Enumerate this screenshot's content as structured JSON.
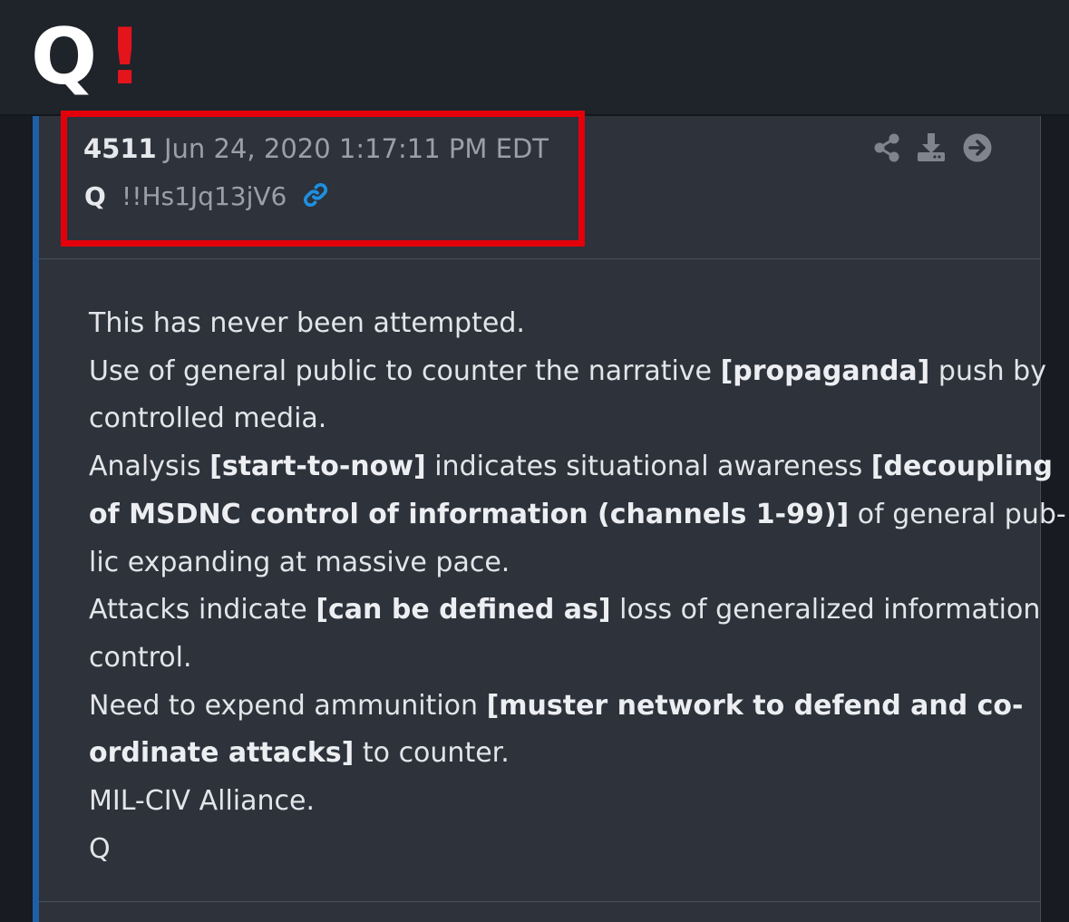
{
  "header": {
    "logo_letter": "Q",
    "logo_mark": "!"
  },
  "post": {
    "number": "4511",
    "date": "Jun 24, 2020 1:17:11 PM EDT",
    "author": "Q",
    "tripcode": "!!Hs1Jq13jV6",
    "icons": {
      "link": "link-icon",
      "share": "share-icon",
      "download": "download-icon",
      "open": "arrow-circle-right-icon"
    },
    "colors": {
      "highlight": "#e3000b",
      "link_icon": "#1e8fe0",
      "accent_border": "#1f5fa5"
    },
    "body": {
      "l1": "This has never been attempted.",
      "l2a": "Use of general public to counter the narrative ",
      "l2b": "[propaganda]",
      "l2c": " push by",
      "l3": "controlled media.",
      "l4a": "Analysis ",
      "l4b": "[start-to-now]",
      "l4c": " indicates situational awareness ",
      "l4d": "[decoupling",
      "l5a": "of MSDNC control of information (channels 1-99)]",
      "l5b": " of general pub-",
      "l6": "lic expanding at massive pace.",
      "l7a": "Attacks indicate ",
      "l7b": "[can be defined as]",
      "l7c": " loss of generalized information",
      "l8": "control.",
      "l9a": "Need to expend ammunition ",
      "l9b": "[muster network to defend and co-",
      "l10a": "ordinate attacks]",
      "l10b": " to counter.",
      "l11": "MIL-CIV Alliance.",
      "l12": "Q"
    }
  }
}
